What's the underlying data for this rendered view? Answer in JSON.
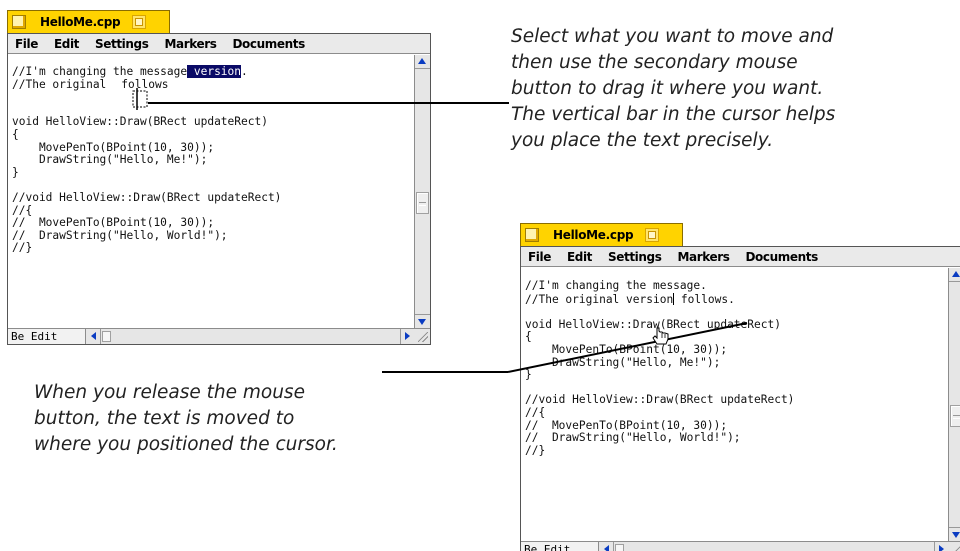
{
  "window_before": {
    "title": "HelloMe.cpp",
    "menu": [
      "File",
      "Edit",
      "Settings",
      "Markers",
      "Documents"
    ],
    "code": {
      "line1_pre": "//I'm changing the message",
      "line1_sel": " version",
      "line1_post": ".",
      "line2_pre": "//The original",
      "line2_post": "follows",
      "rest": "\n\n\nvoid HelloView::Draw(BRect updateRect)\n{\n    MovePenTo(BPoint(10, 30));\n    DrawString(\"Hello, Me!\");\n}\n\n//void HelloView::Draw(BRect updateRect)\n//{\n//  MovePenTo(BPoint(10, 30));\n//  DrawString(\"Hello, World!\");\n//}"
    },
    "status": "Be Edit",
    "scroll_position": 0.55
  },
  "window_after": {
    "title": "HelloMe.cpp",
    "menu": [
      "File",
      "Edit",
      "Settings",
      "Markers",
      "Documents"
    ],
    "code": {
      "line1": "//I'm changing the message.",
      "line2_pre": "//The original version",
      "line2_post": " follows.",
      "rest": "\n\nvoid HelloView::Draw(BRect updateRect)\n{\n    MovePenTo(BPoint(10, 30));\n    DrawString(\"Hello, Me!\");\n}\n\n//void HelloView::Draw(BRect updateRect)\n//{\n//  MovePenTo(BPoint(10, 30));\n//  DrawString(\"Hello, World!\");\n//}"
    },
    "status": "Be Edit",
    "scroll_position": 0.55
  },
  "callouts": {
    "drag": "Select what you want to move and\nthen use the secondary mouse\nbutton to drag it where you want.\nThe vertical bar in the cursor helps\nyou place the text precisely.",
    "release": "When you release the mouse\nbutton, the text is moved to\nwhere you positioned the cursor."
  },
  "colors": {
    "tab": "#ffd300",
    "selection": "#0a0a66",
    "scroll_arrow": "#0a3cc2"
  },
  "icons": [
    "close-box-icon",
    "zoom-box-icon",
    "scroll-up-arrow-icon",
    "scroll-down-arrow-icon",
    "scroll-left-arrow-icon",
    "scroll-right-arrow-icon",
    "resize-grip-icon",
    "drag-cursor-icon",
    "hand-cursor-icon"
  ]
}
